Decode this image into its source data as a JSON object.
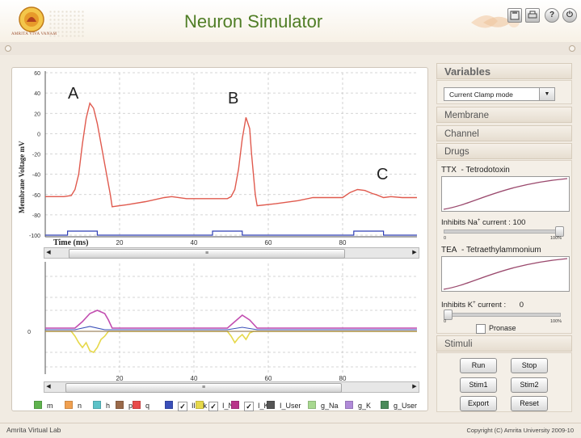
{
  "app": {
    "title": "Neuron Simulator",
    "logo_text": "AMRITA VIVA VANAM"
  },
  "header_icons": [
    {
      "name": "save-icon"
    },
    {
      "name": "print-icon"
    },
    {
      "name": "help-icon",
      "glyph": "?"
    },
    {
      "name": "power-icon",
      "glyph": "⏻"
    }
  ],
  "colors": {
    "accent_green": "#4f7d25",
    "voltage_line": "#e05a4e",
    "stim_line": "#2f3fb5",
    "panel_bg": "#f1ebe2"
  },
  "top_chart": {
    "peak_labels": [
      "A",
      "B",
      "C"
    ],
    "y_ticks": [
      "60",
      "40",
      "20",
      "0",
      "-20",
      "-40",
      "-60",
      "-80",
      "-100"
    ],
    "x_ticks": [
      "20",
      "40",
      "60",
      "80"
    ],
    "ylabel": "Membrane Voltage mV",
    "xlabel": "Time (ms)"
  },
  "bottom_chart": {
    "y_ticks": [
      "0"
    ],
    "x_ticks": [
      "20",
      "40",
      "60",
      "80"
    ]
  },
  "scrollbars": {
    "left_arrow": "◀",
    "right_arrow": "▶",
    "grip": "≡"
  },
  "legend": [
    {
      "label": "m",
      "color": "#5fb34e",
      "checked": false
    },
    {
      "label": "n",
      "color": "#f0a050",
      "checked": false
    },
    {
      "label": "h",
      "color": "#5cc2c8",
      "checked": false
    },
    {
      "label": "p",
      "color": "#9a6a4a",
      "checked": false
    },
    {
      "label": "q",
      "color": "#e84a4a",
      "checked": false
    },
    {
      "label": "Ileak",
      "color": "#3a4fb8",
      "checked": true
    },
    {
      "label": "I_Na",
      "color": "#e6d84a",
      "checked": true
    },
    {
      "label": "I_K",
      "color": "#b8348a",
      "checked": true
    },
    {
      "label": "I_User",
      "color": "#555555",
      "checked": false
    },
    {
      "label": "g_Na",
      "color": "#a8d890",
      "checked": false
    },
    {
      "label": "g_K",
      "color": "#b08ad8",
      "checked": false
    },
    {
      "label": "g_User",
      "color": "#4a8a5a",
      "checked": false
    }
  ],
  "sidebar": {
    "variables_title": "Variables",
    "mode_select": "Current Clamp mode",
    "sections": [
      "Membrane",
      "Channel",
      "Drugs"
    ],
    "ttx": {
      "name": "TTX",
      "desc": "- Tetrodotoxin",
      "inhibit_label": "Inhibits Na",
      "inhibit_suffix": " current : 100",
      "scale_min": "0",
      "scale_max": "100%",
      "value": 100
    },
    "tea": {
      "name": "TEA",
      "desc": "- Tetraethylammonium",
      "inhibit_label": "Inhibits K",
      "inhibit_suffix": " current :",
      "value_text": "0",
      "scale_min": "0",
      "scale_max": "100%",
      "value": 0
    },
    "superscript": "+",
    "pronase_label": "Pronase",
    "stimuli_title": "Stimuli",
    "buttons": {
      "run": "Run",
      "stop": "Stop",
      "stim1": "Stim1",
      "stim2": "Stim2",
      "export": "Export",
      "reset": "Reset"
    }
  },
  "footer": {
    "left": "Amrita Virtual Lab",
    "right": "Copyright (C) Amrita University 2009-10"
  }
}
